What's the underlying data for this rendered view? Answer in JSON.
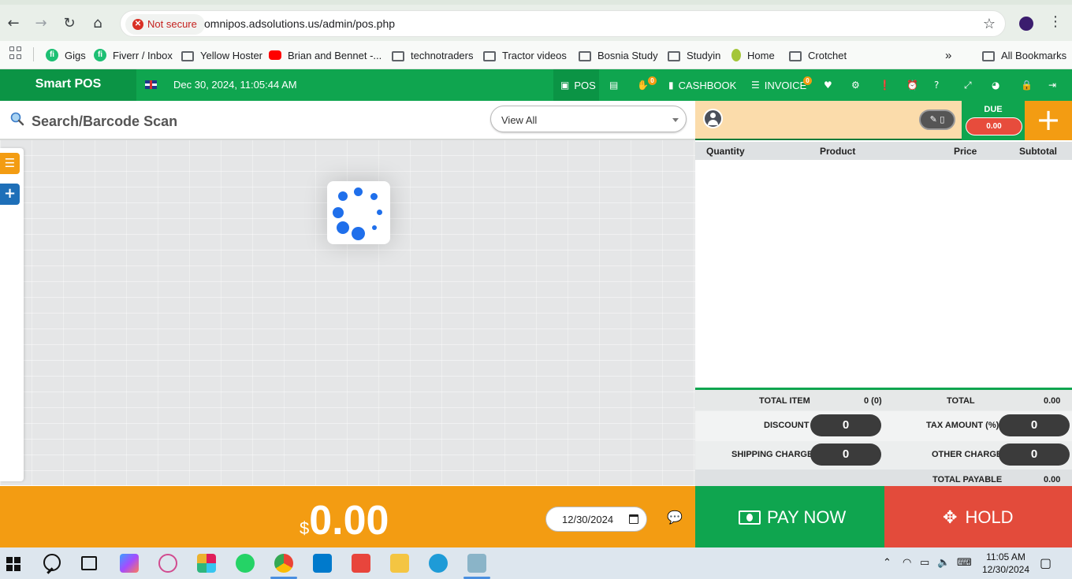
{
  "browser": {
    "security_label": "Not secure",
    "url": "omnipos.adsolutions.us/admin/pos.php",
    "bookmarks": [
      {
        "label": "Gigs",
        "icon": "fiverr-icon"
      },
      {
        "label": "Fiverr / Inbox",
        "icon": "fiverr-icon"
      },
      {
        "label": "Yellow Hoster",
        "icon": "folder-icon"
      },
      {
        "label": "Brian and Bennet -...",
        "icon": "youtube-icon"
      },
      {
        "label": "technotraders",
        "icon": "folder-icon"
      },
      {
        "label": "Tractor videos",
        "icon": "folder-icon"
      },
      {
        "label": "Bosnia Study",
        "icon": "folder-icon"
      },
      {
        "label": "Studyin",
        "icon": "folder-icon"
      },
      {
        "label": "Home",
        "icon": "bonanza-icon"
      },
      {
        "label": "Crotchet",
        "icon": "folder-icon"
      }
    ],
    "overflow_label": "»",
    "all_bookmarks": "All Bookmarks"
  },
  "header": {
    "brand": "Smart POS",
    "datetime": "Dec 30, 2024, 11:05:44 AM",
    "pos_label": "POS",
    "cashbook_label": "CASHBOOK",
    "invoice_label": "INVOICE",
    "hold_badge": "0",
    "invoice_badge": "0"
  },
  "left": {
    "search_placeholder": "Search/Barcode Scan",
    "category_select": "View All"
  },
  "customer": {
    "due_label": "DUE",
    "due_value": "0.00",
    "add_symbol": "+"
  },
  "cart": {
    "columns": [
      "Quantity",
      "Product",
      "Price",
      "Subtotal"
    ]
  },
  "totals": {
    "total_item_label": "TOTAL ITEM",
    "total_item_value": "0 (0)",
    "total_label": "TOTAL",
    "total_value": "0.00",
    "discount_label": "DISCOUNT",
    "discount_value": "0",
    "tax_label": "TAX AMOUNT (%)",
    "tax_value": "0",
    "shipping_label": "SHIPPING CHARGE",
    "shipping_value": "0",
    "other_label": "OTHER CHARGE",
    "other_value": "0",
    "payable_label": "TOTAL PAYABLE",
    "payable_value": "0.00"
  },
  "footer": {
    "currency": "$",
    "amount": "0.00",
    "date": "12/30/2024",
    "pay_now": "PAY NOW",
    "hold": "HOLD"
  },
  "taskbar": {
    "time": "11:05 AM",
    "date": "12/30/2024"
  },
  "colors": {
    "brand_green": "#0fa54f",
    "orange": "#f39c12",
    "red": "#e34b3b"
  }
}
